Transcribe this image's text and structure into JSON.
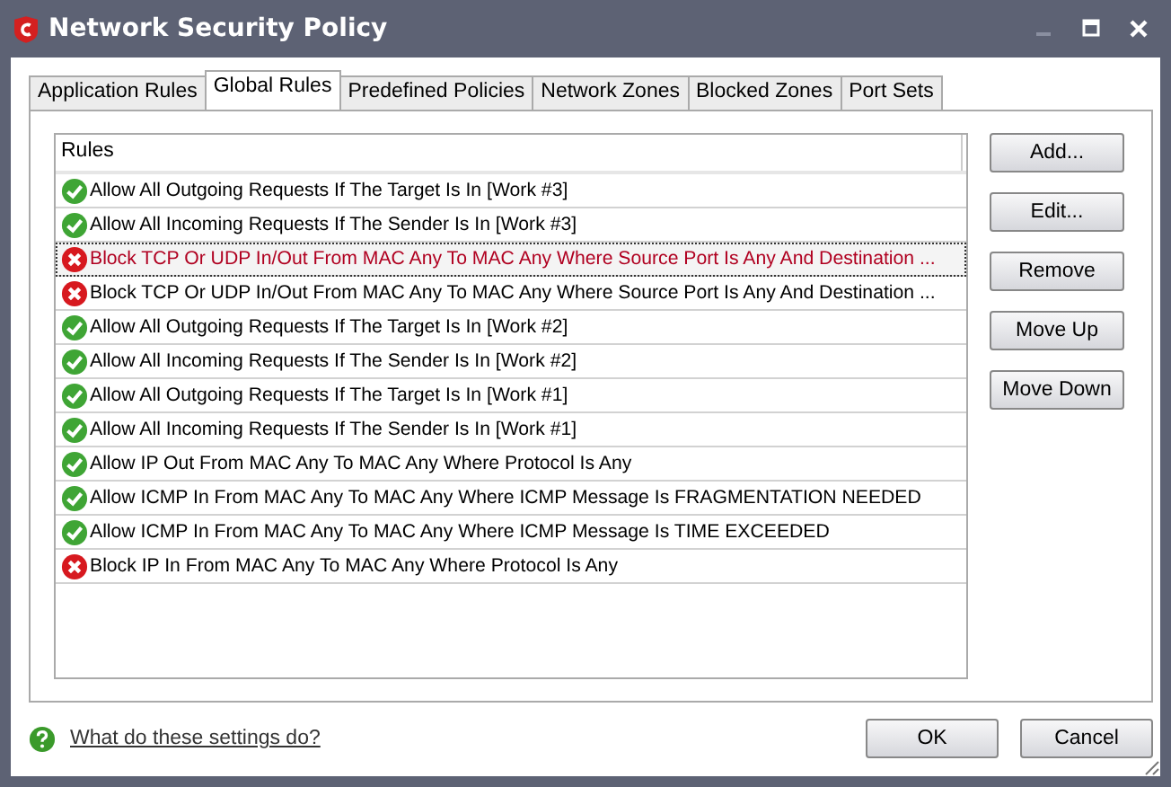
{
  "window": {
    "title": "Network Security Policy"
  },
  "tabs": [
    {
      "label": "Application Rules",
      "selected": false
    },
    {
      "label": "Global Rules",
      "selected": true
    },
    {
      "label": "Predefined Policies",
      "selected": false
    },
    {
      "label": "Network Zones",
      "selected": false
    },
    {
      "label": "Blocked Zones",
      "selected": false
    },
    {
      "label": "Port Sets",
      "selected": false
    }
  ],
  "table": {
    "columns": [
      "Rules"
    ],
    "rows": [
      {
        "kind": "allow",
        "text": "Allow All Outgoing Requests If The Target Is In [Work #3]",
        "selected": false
      },
      {
        "kind": "allow",
        "text": "Allow All Incoming Requests If The Sender Is In [Work #3]",
        "selected": false
      },
      {
        "kind": "block",
        "text": "Block TCP Or UDP In/Out From MAC Any To MAC Any Where Source Port Is Any And Destination ...",
        "selected": true
      },
      {
        "kind": "block",
        "text": "Block TCP Or UDP In/Out From MAC Any To MAC Any Where Source Port Is Any And Destination ...",
        "selected": false
      },
      {
        "kind": "allow",
        "text": "Allow All Outgoing Requests If The Target Is In [Work #2]",
        "selected": false
      },
      {
        "kind": "allow",
        "text": "Allow All Incoming Requests If The Sender Is In [Work #2]",
        "selected": false
      },
      {
        "kind": "allow",
        "text": "Allow All Outgoing Requests If The Target Is In [Work #1]",
        "selected": false
      },
      {
        "kind": "allow",
        "text": "Allow All Incoming Requests If The Sender Is In [Work #1]",
        "selected": false
      },
      {
        "kind": "allow",
        "text": "Allow IP Out From MAC Any To MAC Any Where Protocol Is Any",
        "selected": false
      },
      {
        "kind": "allow",
        "text": "Allow ICMP In From MAC Any To MAC Any Where ICMP Message Is FRAGMENTATION NEEDED",
        "selected": false
      },
      {
        "kind": "allow",
        "text": "Allow ICMP In From MAC Any To MAC Any Where ICMP Message Is TIME EXCEEDED",
        "selected": false
      },
      {
        "kind": "block",
        "text": "Block IP In From MAC Any To MAC Any Where Protocol Is Any",
        "selected": false
      }
    ]
  },
  "side_buttons": [
    "Add...",
    "Edit...",
    "Remove",
    "Move Up",
    "Move Down"
  ],
  "help_link": "What do these settings do?",
  "buttons": [
    "OK",
    "Cancel"
  ]
}
